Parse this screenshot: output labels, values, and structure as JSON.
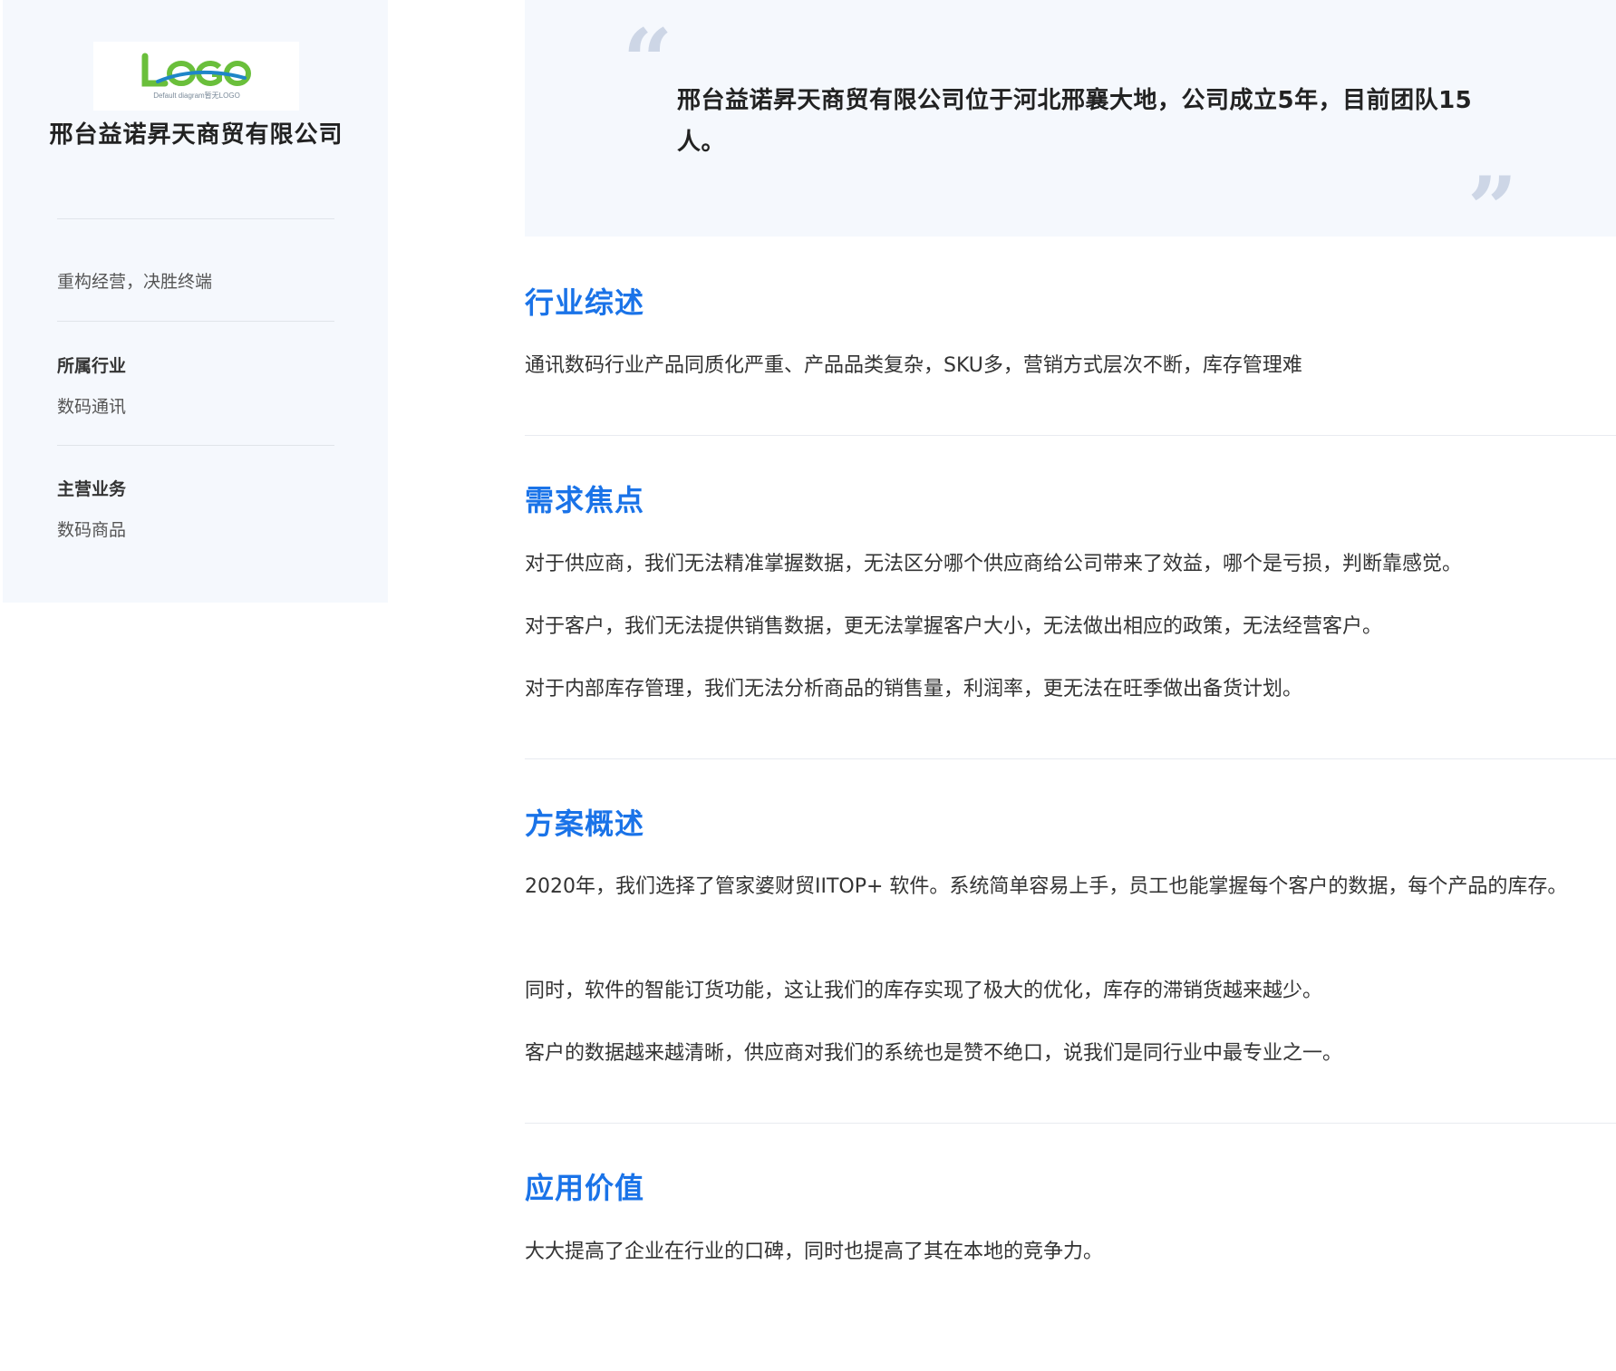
{
  "sidebar": {
    "logo": {
      "text": "LOGO",
      "subtext": "Default diagram暂无LOGO",
      "colors": {
        "green": "#6abf3b",
        "blue": "#1f86c8"
      }
    },
    "company_name": "邢台益诺昇天商贸有限公司",
    "slogan": "重构经营，决胜终端",
    "industry_label": "所属行业",
    "industry_value": "数码通讯",
    "business_label": "主营业务",
    "business_value": "数码商品"
  },
  "quote": {
    "text": "邢台益诺昇天商贸有限公司位于河北邢襄大地，公司成立5年，目前团队15人。",
    "open_mark": "“",
    "close_mark": "”"
  },
  "sections": [
    {
      "title": "行业综述",
      "paragraphs": [
        "通讯数码行业产品同质化严重、产品品类复杂，SKU多，营销方式层次不断，库存管理难"
      ]
    },
    {
      "title": "需求焦点",
      "paragraphs": [
        "对于供应商，我们无法精准掌握数据，无法区分哪个供应商给公司带来了效益，哪个是亏损，判断靠感觉。",
        "对于客户，我们无法提供销售数据，更无法掌握客户大小，无法做出相应的政策，无法经营客户。",
        "对于内部库存管理，我们无法分析商品的销售量，利润率，更无法在旺季做出备货计划。"
      ]
    },
    {
      "title": "方案概述",
      "paragraphs": [
        "2020年，我们选择了管家婆财贸IITOP+ 软件。系统简单容易上手，员工也能掌握每个客户的数据，每个产品的库存。",
        "同时，软件的智能订货功能，这让我们的库存实现了极大的优化，库存的滞销货越来越少。",
        "客户的数据越来越清晰，供应商对我们的系统也是赞不绝口，说我们是同行业中最专业之一。"
      ]
    },
    {
      "title": "应用价值",
      "paragraphs": [
        "大大提高了企业在行业的口碑，同时也提高了其在本地的竞争力。"
      ]
    }
  ],
  "colors": {
    "accent": "#1a73e8",
    "panel_bg": "#f5f8fd",
    "quote_mark": "#cdd6e6"
  }
}
